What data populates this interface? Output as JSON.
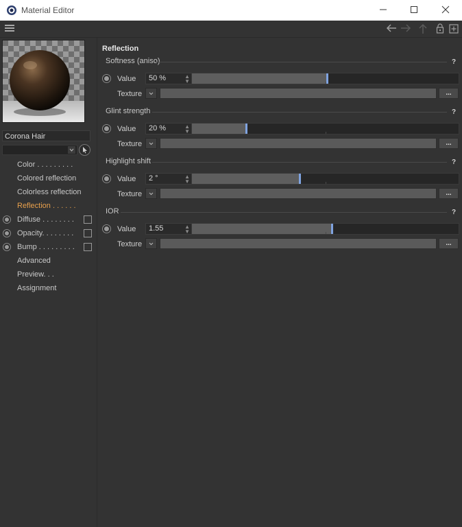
{
  "window": {
    "title": "Material Editor",
    "minimize_icon": "minimize-icon",
    "maximize_icon": "maximize-icon",
    "close_icon": "close-icon"
  },
  "toolbar": {
    "menu_icon": "hamburger-menu-icon",
    "back_icon": "arrow-left-icon",
    "forward_icon": "arrow-right-icon",
    "up_icon": "arrow-up-icon",
    "lock_icon": "lock-icon",
    "new_icon": "new-window-icon"
  },
  "sidebar": {
    "material_name": "Corona Hair",
    "items": [
      {
        "label": "Color . . . . . . . . .",
        "active": false,
        "radio": false,
        "checkbox": false
      },
      {
        "label": "Colored reflection",
        "active": false,
        "radio": false,
        "checkbox": false
      },
      {
        "label": "Colorless reflection",
        "active": false,
        "radio": false,
        "checkbox": false
      },
      {
        "label": "Reflection . . . . . .",
        "active": true,
        "radio": false,
        "checkbox": false
      },
      {
        "label": "Diffuse . . . . . . . .",
        "active": false,
        "radio": true,
        "checkbox": true
      },
      {
        "label": "Opacity. . . . . . . .",
        "active": false,
        "radio": true,
        "checkbox": true
      },
      {
        "label": "Bump . . . . . . . . .",
        "active": false,
        "radio": true,
        "checkbox": true
      },
      {
        "label": "Advanced",
        "active": false,
        "radio": false,
        "checkbox": false
      },
      {
        "label": "Preview. . .",
        "active": false,
        "radio": false,
        "checkbox": false
      },
      {
        "label": "Assignment",
        "active": false,
        "radio": false,
        "checkbox": false
      }
    ]
  },
  "main": {
    "section_title": "Reflection",
    "help_label": "?",
    "value_label": "Value",
    "texture_label": "Texture",
    "texture_button": "...",
    "groups": [
      {
        "title": "Softness (aniso)",
        "value": "50 %",
        "slider_fraction": 0.5
      },
      {
        "title": "Glint strength",
        "value": "20 %",
        "slider_fraction": 0.2
      },
      {
        "title": "Highlight shift",
        "value": "2 °",
        "slider_fraction": 0.4
      },
      {
        "title": "IOR",
        "value": "1.55",
        "slider_fraction": 0.52
      }
    ]
  },
  "colors": {
    "accent_active": "#e8a04c",
    "slider_knob": "#7fa3e0",
    "background": "#333333"
  }
}
